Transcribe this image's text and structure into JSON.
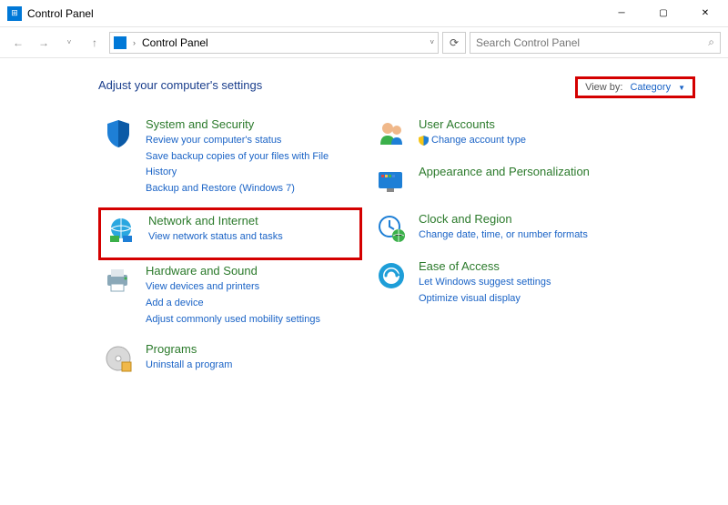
{
  "window": {
    "title": "Control Panel"
  },
  "address": {
    "root": "Control Panel"
  },
  "search": {
    "placeholder": "Search Control Panel"
  },
  "heading": "Adjust your computer's settings",
  "viewby": {
    "label": "View by:",
    "value": "Category"
  },
  "left": [
    {
      "title": "System and Security",
      "links": [
        "Review your computer's status",
        "Save backup copies of your files with File History",
        "Backup and Restore (Windows 7)"
      ]
    },
    {
      "title": "Network and Internet",
      "links": [
        "View network status and tasks"
      ],
      "highlight": true
    },
    {
      "title": "Hardware and Sound",
      "links": [
        "View devices and printers",
        "Add a device",
        "Adjust commonly used mobility settings"
      ]
    },
    {
      "title": "Programs",
      "links": [
        "Uninstall a program"
      ]
    }
  ],
  "right": [
    {
      "title": "User Accounts",
      "links": [
        "Change account type"
      ]
    },
    {
      "title": "Appearance and Personalization",
      "links": []
    },
    {
      "title": "Clock and Region",
      "links": [
        "Change date, time, or number formats"
      ]
    },
    {
      "title": "Ease of Access",
      "links": [
        "Let Windows suggest settings",
        "Optimize visual display"
      ]
    }
  ]
}
